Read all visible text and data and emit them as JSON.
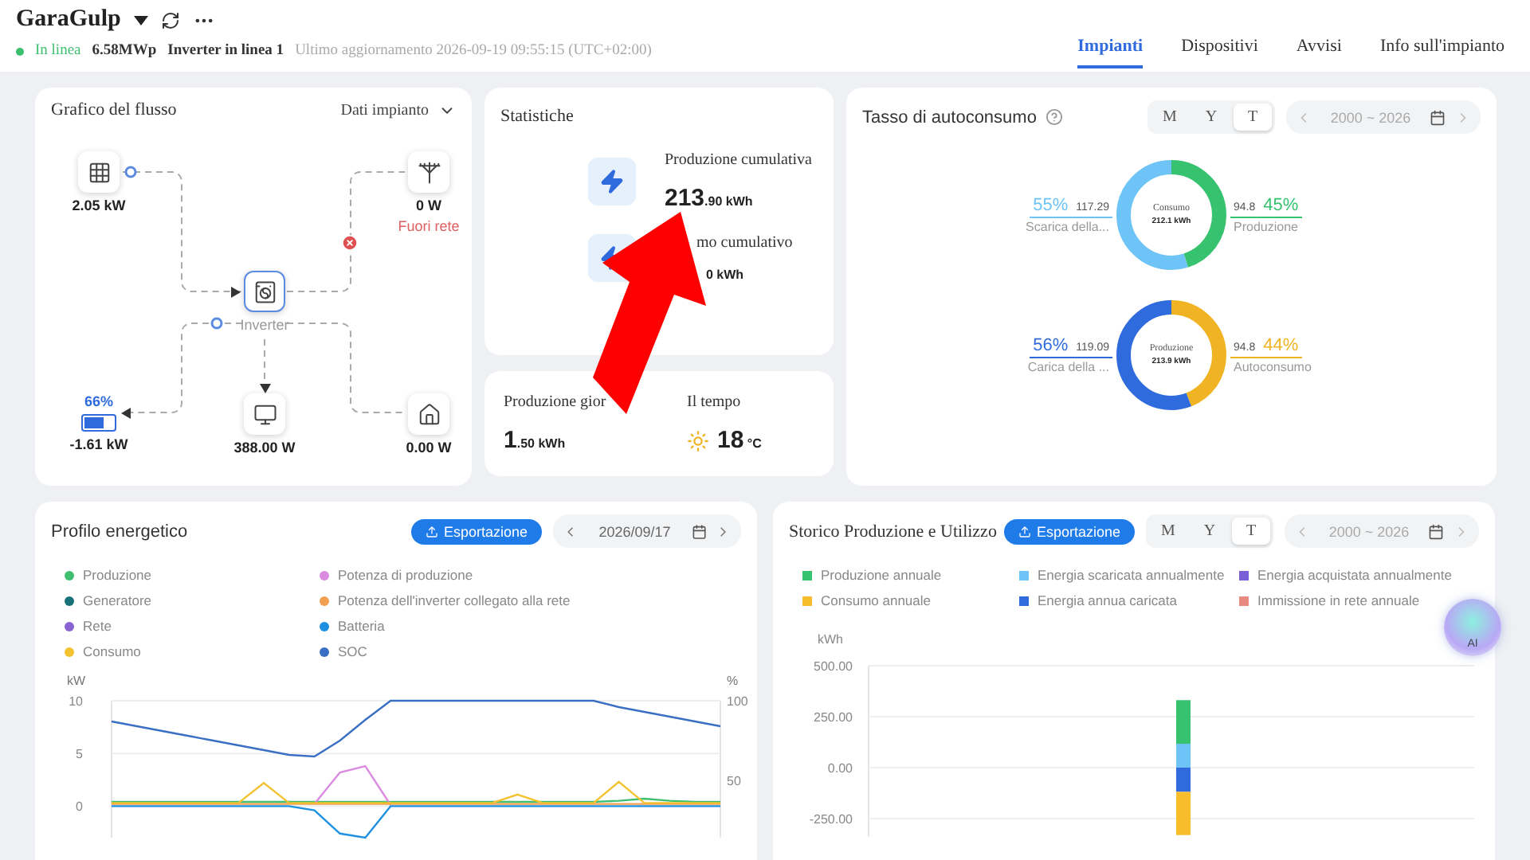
{
  "header": {
    "title": "GaraGulp",
    "status": "In linea",
    "capacity": "6.58MWp",
    "inverters": "Inverter in linea 1",
    "updated": "Ultimo aggiornamento 2026-09-19 09:55:15 (UTC+02:00)"
  },
  "tabs": [
    {
      "label": "Impianti",
      "selected": true
    },
    {
      "label": "Dispositivi",
      "selected": false
    },
    {
      "label": "Avvisi",
      "selected": false
    },
    {
      "label": "Info sull'impianto",
      "selected": false
    }
  ],
  "flow": {
    "title": "Grafico del flusso",
    "dropdown": "Dati impianto",
    "nodes": [
      {
        "kind": "solar",
        "value": "2.05 kW"
      },
      {
        "kind": "grid",
        "value": "0 W",
        "status": "Fuori rete"
      },
      {
        "kind": "inverter",
        "label": "Inverter"
      },
      {
        "kind": "battery",
        "soc": "66%",
        "level": 0.66,
        "value": "-1.61 kW"
      },
      {
        "kind": "ups",
        "value": "388.00 W"
      },
      {
        "kind": "home",
        "value": "0.00 W"
      }
    ]
  },
  "stats": {
    "title": "Statistiche",
    "items": [
      {
        "label": "Produzione cumulativa",
        "value": "213",
        "unit": ".90 kWh"
      },
      {
        "label": "mo cumulativo",
        "unit": "0 kWh"
      }
    ]
  },
  "daily": {
    "label": "Produzione gior",
    "value": "1",
    "unit": ".50 kWh"
  },
  "weather": {
    "label": "Il tempo",
    "value": "18",
    "unit": "°C"
  },
  "self_consumption": {
    "title": "Tasso di autoconsumo",
    "periods": [
      {
        "label": "M",
        "selected": false
      },
      {
        "label": "Y",
        "selected": false
      },
      {
        "label": "T",
        "selected": true
      }
    ],
    "range": "2000 ~ 2026",
    "donuts": [
      {
        "center_label": "Consumo",
        "center_value": "212.1",
        "center_unit": "kWh",
        "right": {
          "percent": "45%",
          "value": "94.8"
        },
        "left": {
          "percent": "55%",
          "value": "117.29"
        },
        "chart_data": {
          "type": "donut",
          "categories": [
            "Produzione",
            "Scarica della..."
          ],
          "values": [
            45,
            55
          ],
          "colors": [
            "#36c26e",
            "#6ec3f7"
          ]
        }
      },
      {
        "center_label": "Produzione",
        "center_value": "213.9",
        "center_unit": "kWh",
        "right": {
          "percent": "44%",
          "value": "94.8"
        },
        "left": {
          "percent": "56%",
          "value": "119.09"
        },
        "chart_data": {
          "type": "donut",
          "categories": [
            "Autoconsumo",
            "Carica della ..."
          ],
          "values": [
            44,
            56
          ],
          "colors": [
            "#f0b323",
            "#2f6bdc"
          ]
        }
      }
    ]
  },
  "profile": {
    "title": "Profilo energetico",
    "export": "Esportazione",
    "date": "2026/09/17",
    "chart_data": {
      "type": "line",
      "ylabel": "kW",
      "y2label": "%",
      "ylim": [
        -3,
        10
      ],
      "y2lim": [
        14,
        100
      ],
      "yticks": [
        0,
        5,
        10
      ],
      "y2ticks": [
        50,
        100
      ],
      "grid": true,
      "series": [
        {
          "name": "Produzione",
          "color": "#3fbf6f",
          "values": [
            0.4,
            0.4,
            0.4,
            0.4,
            0.4,
            0.4,
            0.4,
            0.4,
            0.4,
            0.4,
            0.4,
            0.4,
            0.4,
            0.4,
            0.4,
            0.4,
            0.4,
            0.4,
            0.4,
            0.4,
            0.5,
            0.7,
            0.5,
            0.4,
            0.4
          ]
        },
        {
          "name": "Potenza di produzione",
          "color": "#d98be0",
          "values": [
            null,
            null,
            null,
            null,
            null,
            null,
            null,
            null,
            0.2,
            3.2,
            3.8,
            0.1,
            null,
            null,
            null,
            null,
            null,
            null,
            null,
            null,
            null,
            null,
            null,
            null,
            null
          ]
        },
        {
          "name": "Generatore",
          "color": "#17727a",
          "values": [
            null,
            null,
            null,
            null,
            null,
            null,
            null,
            null,
            null,
            null,
            null,
            null,
            null,
            null,
            null,
            null,
            null,
            null,
            null,
            null,
            null,
            null,
            null,
            null,
            null
          ]
        },
        {
          "name": "Potenza dell'inverter collegato alla rete",
          "color": "#f0a050",
          "values": [
            0.2,
            0.2,
            0.2,
            0.2,
            0.2,
            0.2,
            0.2,
            0.2,
            0.2,
            0.2,
            0.2,
            0.2,
            0.2,
            0.2,
            0.2,
            0.2,
            0.2,
            0.2,
            0.2,
            0.2,
            0.2,
            0.2,
            0.2,
            0.2,
            0.2
          ]
        },
        {
          "name": "Rete",
          "color": "#8a63d2",
          "values": [
            null,
            null,
            null,
            null,
            null,
            null,
            null,
            null,
            null,
            null,
            null,
            null,
            null,
            null,
            null,
            null,
            null,
            null,
            null,
            null,
            null,
            null,
            null,
            null,
            null
          ]
        },
        {
          "name": "Batteria",
          "color": "#1e90e0",
          "values": [
            0,
            0,
            0,
            0,
            0,
            0,
            0,
            0,
            -0.4,
            -2.6,
            -3,
            0,
            0,
            0,
            0,
            0,
            0,
            0,
            0,
            0,
            0,
            0,
            0,
            0,
            0
          ]
        },
        {
          "name": "Consumo",
          "color": "#f2c230",
          "values": [
            0.3,
            0.3,
            0.3,
            0.3,
            0.3,
            0.3,
            2.2,
            0.3,
            0.3,
            0.3,
            0.3,
            0.3,
            0.3,
            0.3,
            0.3,
            0.3,
            1.1,
            0.3,
            0.3,
            0.3,
            2.3,
            0.3,
            0.3,
            0.3,
            0.3
          ]
        },
        {
          "name": "SOC",
          "color": "#3a6fc4",
          "axis": "y2",
          "values": [
            87,
            84,
            81,
            78,
            75,
            72,
            69,
            66,
            65,
            75,
            88,
            100,
            100,
            100,
            100,
            100,
            100,
            100,
            100,
            100,
            96,
            93,
            90,
            87,
            84
          ]
        }
      ]
    }
  },
  "history": {
    "title": "Storico Produzione e Utilizzo",
    "export": "Esportazione",
    "periods": [
      {
        "label": "M",
        "selected": false
      },
      {
        "label": "Y",
        "selected": false
      },
      {
        "label": "T",
        "selected": true
      }
    ],
    "range": "2000 ~ 2026",
    "chart_data": {
      "type": "bar",
      "stacked": true,
      "ylabel": "kWh",
      "ylim": [
        -340,
        500
      ],
      "grid": true,
      "yticks": [
        {
          "value": -250,
          "label": "-250.00"
        },
        {
          "value": 0,
          "label": "0.00"
        },
        {
          "value": 250,
          "label": "250.00"
        },
        {
          "value": 500,
          "label": "500.00"
        }
      ],
      "series": [
        {
          "name": "Produzione annuale",
          "color": "#36c26e",
          "values": [
            214
          ]
        },
        {
          "name": "Energia scaricata annualmente",
          "color": "#6ec3f7",
          "values": [
            117
          ]
        },
        {
          "name": "Energia acquistata annualmente",
          "color": "#7b5fd6",
          "values": [
            0
          ]
        },
        {
          "name": "Consumo annuale",
          "color": "#f7bd2a",
          "values": [
            -212
          ]
        },
        {
          "name": "Energia annua caricata",
          "color": "#2f6bdc",
          "values": [
            -119
          ]
        },
        {
          "name": "Immissione in rete annuale",
          "color": "#e98a80",
          "values": [
            0
          ]
        }
      ]
    }
  },
  "assistant": {
    "label": "AI"
  }
}
